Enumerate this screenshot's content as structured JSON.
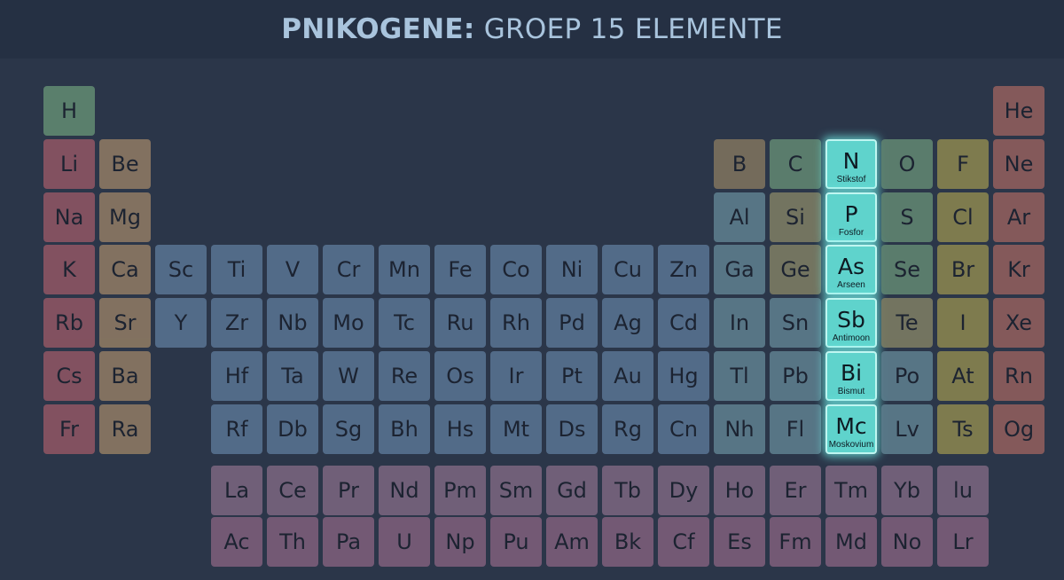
{
  "title": {
    "bold": "PNIKOGENE:",
    "rest": " GROEP 15 ELEMENTE"
  },
  "rows": [
    [
      {
        "col": 1,
        "sym": "H",
        "cat": "hydrogen"
      },
      {
        "col": 18,
        "sym": "He",
        "cat": "noble"
      }
    ],
    [
      {
        "col": 1,
        "sym": "Li",
        "cat": "alkali"
      },
      {
        "col": 2,
        "sym": "Be",
        "cat": "alkaline"
      },
      {
        "col": 13,
        "sym": "B",
        "cat": "b"
      },
      {
        "col": 14,
        "sym": "C",
        "cat": "nonmetal"
      },
      {
        "col": 15,
        "sym": "N",
        "cat": "nonmetal",
        "hl": true,
        "name": "Stikstof"
      },
      {
        "col": 16,
        "sym": "O",
        "cat": "nonmetal"
      },
      {
        "col": 17,
        "sym": "F",
        "cat": "halogen"
      },
      {
        "col": 18,
        "sym": "Ne",
        "cat": "noble"
      }
    ],
    [
      {
        "col": 1,
        "sym": "Na",
        "cat": "alkali"
      },
      {
        "col": 2,
        "sym": "Mg",
        "cat": "alkaline"
      },
      {
        "col": 13,
        "sym": "Al",
        "cat": "post"
      },
      {
        "col": 14,
        "sym": "Si",
        "cat": "metalloid"
      },
      {
        "col": 15,
        "sym": "P",
        "cat": "nonmetal",
        "hl": true,
        "name": "Fosfor"
      },
      {
        "col": 16,
        "sym": "S",
        "cat": "nonmetal"
      },
      {
        "col": 17,
        "sym": "Cl",
        "cat": "halogen"
      },
      {
        "col": 18,
        "sym": "Ar",
        "cat": "noble"
      }
    ],
    [
      {
        "col": 1,
        "sym": "K",
        "cat": "alkali"
      },
      {
        "col": 2,
        "sym": "Ca",
        "cat": "alkaline"
      },
      {
        "col": 3,
        "sym": "Sc",
        "cat": "transition"
      },
      {
        "col": 4,
        "sym": "Ti",
        "cat": "transition"
      },
      {
        "col": 5,
        "sym": "V",
        "cat": "transition"
      },
      {
        "col": 6,
        "sym": "Cr",
        "cat": "transition"
      },
      {
        "col": 7,
        "sym": "Mn",
        "cat": "transition"
      },
      {
        "col": 8,
        "sym": "Fe",
        "cat": "transition"
      },
      {
        "col": 9,
        "sym": "Co",
        "cat": "transition"
      },
      {
        "col": 10,
        "sym": "Ni",
        "cat": "transition"
      },
      {
        "col": 11,
        "sym": "Cu",
        "cat": "transition"
      },
      {
        "col": 12,
        "sym": "Zn",
        "cat": "transition"
      },
      {
        "col": 13,
        "sym": "Ga",
        "cat": "post"
      },
      {
        "col": 14,
        "sym": "Ge",
        "cat": "metalloid"
      },
      {
        "col": 15,
        "sym": "As",
        "cat": "metalloid",
        "hl": true,
        "name": "Arseen"
      },
      {
        "col": 16,
        "sym": "Se",
        "cat": "nonmetal"
      },
      {
        "col": 17,
        "sym": "Br",
        "cat": "halogen"
      },
      {
        "col": 18,
        "sym": "Kr",
        "cat": "noble"
      }
    ],
    [
      {
        "col": 1,
        "sym": "Rb",
        "cat": "alkali"
      },
      {
        "col": 2,
        "sym": "Sr",
        "cat": "alkaline"
      },
      {
        "col": 3,
        "sym": "Y",
        "cat": "transition"
      },
      {
        "col": 4,
        "sym": "Zr",
        "cat": "transition"
      },
      {
        "col": 5,
        "sym": "Nb",
        "cat": "transition"
      },
      {
        "col": 6,
        "sym": "Mo",
        "cat": "transition"
      },
      {
        "col": 7,
        "sym": "Tc",
        "cat": "transition"
      },
      {
        "col": 8,
        "sym": "Ru",
        "cat": "transition"
      },
      {
        "col": 9,
        "sym": "Rh",
        "cat": "transition"
      },
      {
        "col": 10,
        "sym": "Pd",
        "cat": "transition"
      },
      {
        "col": 11,
        "sym": "Ag",
        "cat": "transition"
      },
      {
        "col": 12,
        "sym": "Cd",
        "cat": "transition"
      },
      {
        "col": 13,
        "sym": "In",
        "cat": "post"
      },
      {
        "col": 14,
        "sym": "Sn",
        "cat": "post"
      },
      {
        "col": 15,
        "sym": "Sb",
        "cat": "metalloid",
        "hl": true,
        "name": "Antimoon"
      },
      {
        "col": 16,
        "sym": "Te",
        "cat": "metalloid"
      },
      {
        "col": 17,
        "sym": "I",
        "cat": "halogen"
      },
      {
        "col": 18,
        "sym": "Xe",
        "cat": "noble"
      }
    ],
    [
      {
        "col": 1,
        "sym": "Cs",
        "cat": "alkali"
      },
      {
        "col": 2,
        "sym": "Ba",
        "cat": "alkaline"
      },
      {
        "col": 4,
        "sym": "Hf",
        "cat": "transition"
      },
      {
        "col": 5,
        "sym": "Ta",
        "cat": "transition"
      },
      {
        "col": 6,
        "sym": "W",
        "cat": "transition"
      },
      {
        "col": 7,
        "sym": "Re",
        "cat": "transition"
      },
      {
        "col": 8,
        "sym": "Os",
        "cat": "transition"
      },
      {
        "col": 9,
        "sym": "Ir",
        "cat": "transition"
      },
      {
        "col": 10,
        "sym": "Pt",
        "cat": "transition"
      },
      {
        "col": 11,
        "sym": "Au",
        "cat": "transition"
      },
      {
        "col": 12,
        "sym": "Hg",
        "cat": "transition"
      },
      {
        "col": 13,
        "sym": "Tl",
        "cat": "post"
      },
      {
        "col": 14,
        "sym": "Pb",
        "cat": "post"
      },
      {
        "col": 15,
        "sym": "Bi",
        "cat": "post",
        "hl": true,
        "name": "Bismut"
      },
      {
        "col": 16,
        "sym": "Po",
        "cat": "post"
      },
      {
        "col": 17,
        "sym": "At",
        "cat": "halogen"
      },
      {
        "col": 18,
        "sym": "Rn",
        "cat": "noble"
      }
    ],
    [
      {
        "col": 1,
        "sym": "Fr",
        "cat": "alkali"
      },
      {
        "col": 2,
        "sym": "Ra",
        "cat": "alkaline"
      },
      {
        "col": 4,
        "sym": "Rf",
        "cat": "transition"
      },
      {
        "col": 5,
        "sym": "Db",
        "cat": "transition"
      },
      {
        "col": 6,
        "sym": "Sg",
        "cat": "transition"
      },
      {
        "col": 7,
        "sym": "Bh",
        "cat": "transition"
      },
      {
        "col": 8,
        "sym": "Hs",
        "cat": "transition"
      },
      {
        "col": 9,
        "sym": "Mt",
        "cat": "transition"
      },
      {
        "col": 10,
        "sym": "Ds",
        "cat": "transition"
      },
      {
        "col": 11,
        "sym": "Rg",
        "cat": "transition"
      },
      {
        "col": 12,
        "sym": "Cn",
        "cat": "transition"
      },
      {
        "col": 13,
        "sym": "Nh",
        "cat": "post"
      },
      {
        "col": 14,
        "sym": "Fl",
        "cat": "post"
      },
      {
        "col": 15,
        "sym": "Mc",
        "cat": "post",
        "hl": true,
        "name": "Moskovium"
      },
      {
        "col": 16,
        "sym": "Lv",
        "cat": "post"
      },
      {
        "col": 17,
        "sym": "Ts",
        "cat": "halogen"
      },
      {
        "col": 18,
        "sym": "Og",
        "cat": "noble"
      }
    ]
  ],
  "lanthanides": [
    "La",
    "Ce",
    "Pr",
    "Nd",
    "Pm",
    "Sm",
    "Gd",
    "Tb",
    "Dy",
    "Ho",
    "Er",
    "Tm",
    "Yb",
    "lu"
  ],
  "actinides": [
    "Ac",
    "Th",
    "Pa",
    "U",
    "Np",
    "Pu",
    "Am",
    "Bk",
    "Cf",
    "Es",
    "Fm",
    "Md",
    "No",
    "Lr"
  ]
}
